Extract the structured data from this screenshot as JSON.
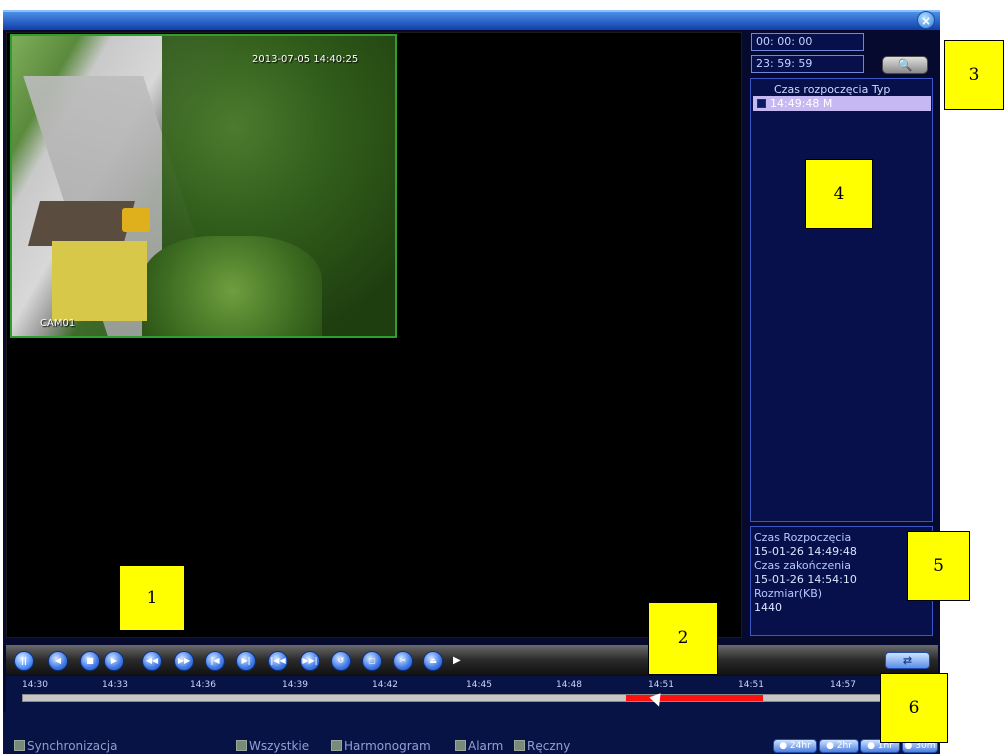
{
  "camera": {
    "timestamp": "2013-07-05 14:40:25",
    "label": "CAM01"
  },
  "search": {
    "start_time": "00: 00: 00",
    "end_time": "23: 59: 59",
    "search_icon": "search-icon"
  },
  "file_list": {
    "header": "Czas rozpoczęcia  Typ",
    "rows": [
      {
        "text": "14:49:48  M"
      }
    ]
  },
  "file_info": {
    "start_label": "Czas Rozpoczęcia",
    "start_value": "15-01-26 14:49:48",
    "end_label": "Czas zakończenia",
    "end_value": "15-01-26 14:54:10",
    "size_label": "Rozmiar(KB)",
    "size_value": "1440"
  },
  "playback_buttons": [
    "pause-icon",
    "prev-frame-icon",
    "stop-icon",
    "play-icon",
    "rewind-icon",
    "fast-forward-icon",
    "prev-file-icon",
    "next-file-icon",
    "skip-back-icon",
    "skip-forward-icon",
    "repeat-icon",
    "window-icon",
    "clip-icon",
    "backup-icon"
  ],
  "playback_glyphs": [
    "||",
    "◀",
    "■",
    "▶",
    "◀◀",
    "▶▶",
    "|◀",
    "▶|",
    "|◀◀",
    "▶▶|",
    "↺",
    "▢",
    "✂",
    "⏏"
  ],
  "timeline": {
    "ticks": [
      "14:30",
      "14:33",
      "14:36",
      "14:39",
      "14:42",
      "14:45",
      "14:48",
      "14:51",
      "14:51",
      "14:57"
    ],
    "record_type": "manual"
  },
  "filters": {
    "sync": "Synchronizacja",
    "all": "Wszystkie",
    "schedule": "Harmonogram",
    "alarm": "Alarm",
    "manual": "Ręczny"
  },
  "ranges": [
    "24hr",
    "2hr",
    "1hr",
    "30m"
  ],
  "callouts": [
    "1",
    "2",
    "3",
    "4",
    "5",
    "6"
  ],
  "colors": {
    "panel_bg": "#050a2e",
    "record_bar": "#ff1010",
    "callout": "#ffff00"
  }
}
